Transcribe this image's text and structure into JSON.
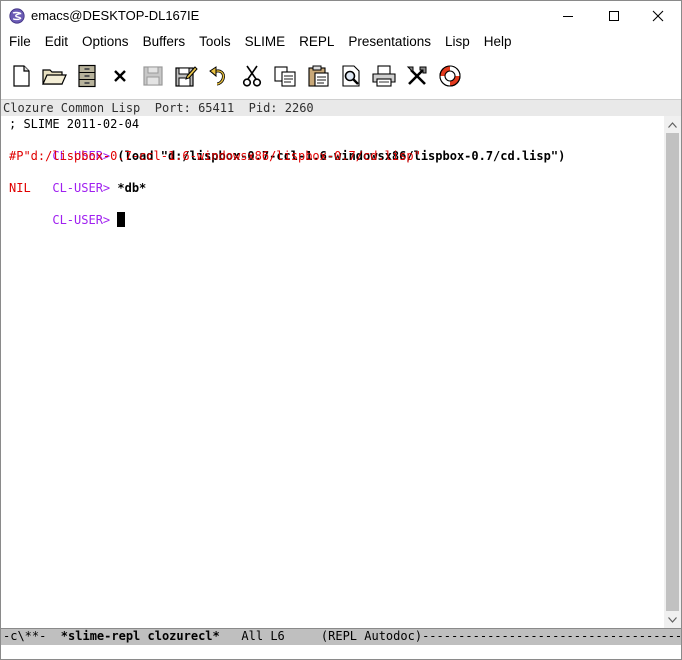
{
  "window": {
    "title": "emacs@DESKTOP-DL167IE"
  },
  "menubar": {
    "items": [
      "File",
      "Edit",
      "Options",
      "Buffers",
      "Tools",
      "SLIME",
      "REPL",
      "Presentations",
      "Lisp",
      "Help"
    ]
  },
  "toolbar": {
    "buttons": [
      {
        "name": "new-file-icon"
      },
      {
        "name": "open-folder-icon"
      },
      {
        "name": "dired-cabinet-icon"
      },
      {
        "name": "close-buffer-icon"
      },
      {
        "name": "save-icon"
      },
      {
        "name": "save-as-icon"
      },
      {
        "name": "undo-icon"
      },
      {
        "name": "cut-icon"
      },
      {
        "name": "copy-icon"
      },
      {
        "name": "paste-icon"
      },
      {
        "name": "search-icon"
      },
      {
        "name": "print-icon"
      },
      {
        "name": "preferences-icon"
      },
      {
        "name": "help-lifebuoy-icon"
      }
    ]
  },
  "header_line": {
    "text": "Clozure Common Lisp  Port: 65411  Pid: 2260"
  },
  "buffer": {
    "lines": [
      {
        "type": "comment",
        "text": "; SLIME 2011-02-04"
      },
      {
        "type": "prompt-input",
        "prompt": "CL-USER>",
        "input": " (load \"d:/lispbox-0.7-ccl-1.6-windowsx86/lispbox-0.7/cd.lisp\")"
      },
      {
        "type": "output",
        "text": "#P\"d:/lispbox-0.7-ccl-1.6-windowsx86/lispbox-0.7/cd.lisp\""
      },
      {
        "type": "prompt-input",
        "prompt": "CL-USER>",
        "input": " *db*"
      },
      {
        "type": "output",
        "text": "NIL"
      },
      {
        "type": "prompt-cursor",
        "prompt": "CL-USER>",
        "input": " "
      }
    ]
  },
  "modeline": {
    "status": "-c\\**-  ",
    "buffer_name": "*slime-repl clozurecl*",
    "position": "   All L6     ",
    "modes": "(REPL Autodoc)",
    "filler": "-------------------------------------------------------"
  },
  "colors": {
    "prompt": "#a020f0",
    "output": "#e00000",
    "modeline_bg": "#bfbfbf",
    "header_bg": "#e9e9e9"
  }
}
